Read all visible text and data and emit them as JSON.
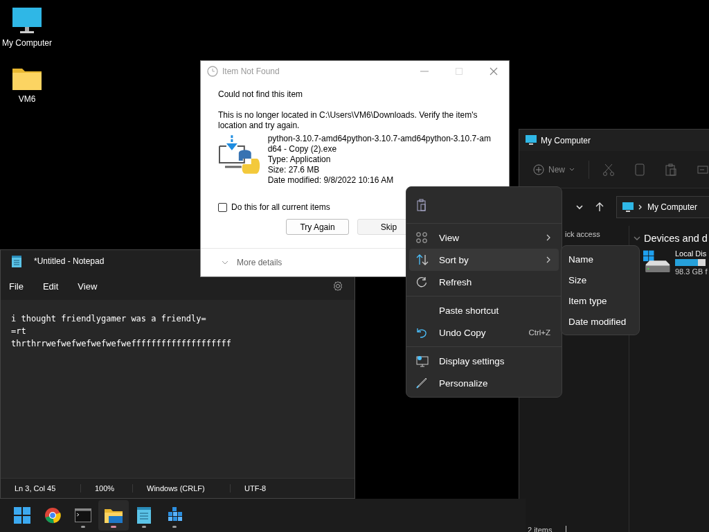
{
  "desktop_icons": [
    {
      "kind": "computer",
      "label": "My Computer"
    },
    {
      "kind": "folder",
      "label": "VM6"
    }
  ],
  "explorer": {
    "title": "My Computer",
    "toolbar": {
      "new_label": "New"
    },
    "address": "My Computer",
    "sidebar_item": "ick access",
    "section": "Devices and d",
    "drive": {
      "name": "Local Dis",
      "level": 0.75,
      "free": "98.3 GB f"
    },
    "status_bar": "2 items"
  },
  "notepad": {
    "title": "*Untitled - Notepad",
    "menu": [
      "File",
      "Edit",
      "View"
    ],
    "lines": [
      "i thought friendlygamer was a friendly=",
      "=rt",
      "thrthrrwefwefwefwefwefweffffffffffffffffffff"
    ],
    "status_bar": [
      "Ln 3, Col 45",
      "100%",
      "Windows (CRLF)",
      "UTF-8"
    ]
  },
  "dialog": {
    "title": "Item Not Found",
    "heading": "Could not find this item",
    "message": "This is no longer located in C:\\Users\\VM6\\Downloads. Verify the item's location and try again.",
    "file_name": "python-3.10.7-amd64python-3.10.7-amd64python-3.10.7-amd64 - Copy (2).exe",
    "details": [
      "Type: Application",
      "Size: 27.6 MB",
      "Date modified: 9/8/2022 10:16 AM"
    ],
    "checkbox": {
      "label": "Do this for all current items",
      "checked": false
    },
    "buttons": [
      "Try Again",
      "Skip"
    ],
    "more_details": "More details"
  },
  "context_menu": {
    "items": [
      {
        "kind": "view",
        "label": "View",
        "submenu": true,
        "selected": false
      },
      {
        "kind": "sort",
        "label": "Sort by",
        "submenu": true,
        "selected": true
      },
      {
        "kind": "refresh",
        "label": "Refresh",
        "submenu": false,
        "selected": false
      },
      {
        "kind": "separator"
      },
      {
        "kind": "plain",
        "label": "Paste shortcut",
        "submenu": false,
        "selected": false
      },
      {
        "kind": "undo",
        "label": "Undo Copy",
        "shortcut": "Ctrl+Z",
        "submenu": false,
        "selected": false
      },
      {
        "kind": "separator"
      },
      {
        "kind": "display",
        "label": "Display settings",
        "submenu": false,
        "selected": false
      },
      {
        "kind": "personalize",
        "label": "Personalize",
        "submenu": false,
        "selected": false
      }
    ],
    "submenu": [
      "Name",
      "Size",
      "Item type",
      "Date modified"
    ]
  },
  "taskbar": [
    {
      "kind": "start"
    },
    {
      "kind": "browser"
    },
    {
      "kind": "terminal",
      "running": true,
      "active": false
    },
    {
      "kind": "folder",
      "running": true,
      "active": true
    },
    {
      "kind": "notepad",
      "running": true,
      "active": false
    },
    {
      "kind": "app",
      "running": true,
      "active": false
    }
  ]
}
